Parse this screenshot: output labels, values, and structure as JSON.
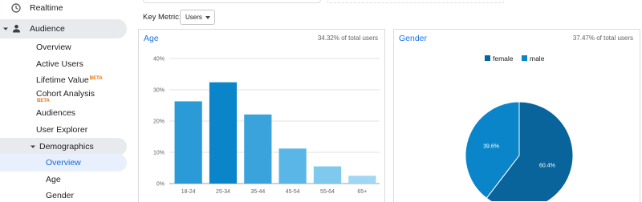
{
  "sidebar": {
    "realtime": "Realtime",
    "audience": "Audience",
    "items": {
      "overview": "Overview",
      "active_users": "Active Users",
      "lifetime_value": "Lifetime Value",
      "lifetime_value_badge": "BETA",
      "cohort_analysis": "Cohort Analysis",
      "cohort_analysis_badge": "BETA",
      "audiences": "Audiences",
      "user_explorer": "User Explorer",
      "demographics": "Demographics",
      "demo_overview": "Overview",
      "demo_age": "Age",
      "demo_gender": "Gender"
    }
  },
  "key_metric": {
    "label": "Key Metric:",
    "value": "Users"
  },
  "age_card": {
    "title": "Age",
    "subtitle": "34.32% of total users"
  },
  "gender_card": {
    "title": "Gender",
    "subtitle": "37.47% of total users"
  },
  "colors": {
    "accent": "#1a73e8",
    "bars": [
      "#2a9bd6",
      "#0b85c9",
      "#3aa3db",
      "#5ab6e6",
      "#7fc8ee",
      "#a1d7f3"
    ],
    "female": "#08649a",
    "male": "#0b85c9",
    "active_bg": "#e8f0fe",
    "badge": "#e8710a"
  },
  "chart_data": [
    {
      "type": "bar",
      "title": "Age",
      "categories": [
        "18-24",
        "25-34",
        "35-44",
        "45-54",
        "55-64",
        "65+"
      ],
      "values": [
        26.3,
        32.4,
        22.1,
        11.2,
        5.5,
        2.5
      ],
      "ylim": [
        0,
        40
      ],
      "yticks": [
        "0%",
        "10%",
        "20%",
        "30%",
        "40%"
      ],
      "grid": true
    },
    {
      "type": "pie",
      "title": "Gender",
      "labels": [
        "female",
        "male"
      ],
      "values": [
        60.4,
        39.6
      ],
      "value_labels": [
        "60.4%",
        "39.6%"
      ],
      "legend": "top"
    }
  ]
}
